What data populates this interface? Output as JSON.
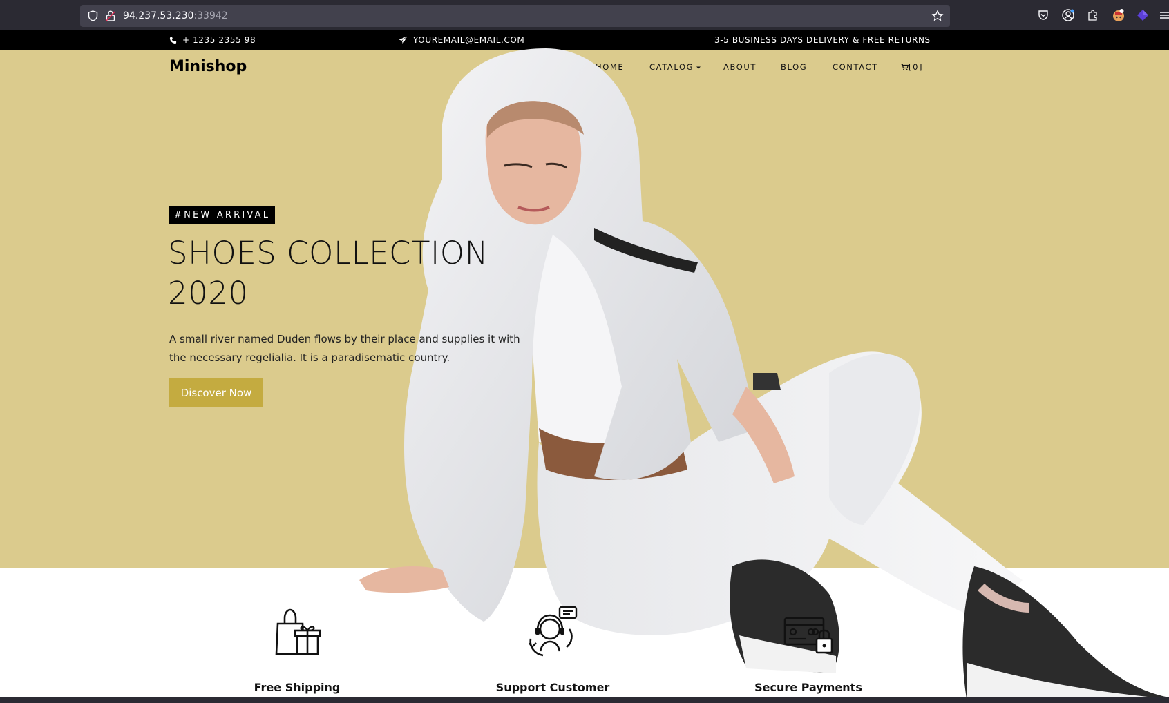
{
  "browser": {
    "url_host": "94.237.53.230",
    "url_port": ":33942"
  },
  "topbar": {
    "phone": "+ 1235 2355 98",
    "email": "YOUREMAIL@EMAIL.COM",
    "delivery": "3-5 BUSINESS DAYS DELIVERY & FREE RETURNS"
  },
  "header": {
    "brand": "Minishop",
    "nav": {
      "home": "HOME",
      "catalog": "CATALOG",
      "about": "ABOUT",
      "blog": "BLOG",
      "contact": "CONTACT",
      "cart": "[0]"
    }
  },
  "hero": {
    "badge": "#NEW ARRIVAL",
    "title_line1": "SHOES COLLECTION",
    "title_line2": "2020",
    "description": "A small river named Duden flows by their place and supplies it with the necessary regelialia. It is a paradisematic country.",
    "cta": "Discover Now",
    "background_color": "#dbcb8d",
    "button_color": "#c4ab40"
  },
  "services": [
    {
      "label": "Free Shipping",
      "icon": "shopping-bag-gift-icon"
    },
    {
      "label": "Support Customer",
      "icon": "customer-support-icon"
    },
    {
      "label": "Secure Payments",
      "icon": "secure-card-icon"
    }
  ]
}
